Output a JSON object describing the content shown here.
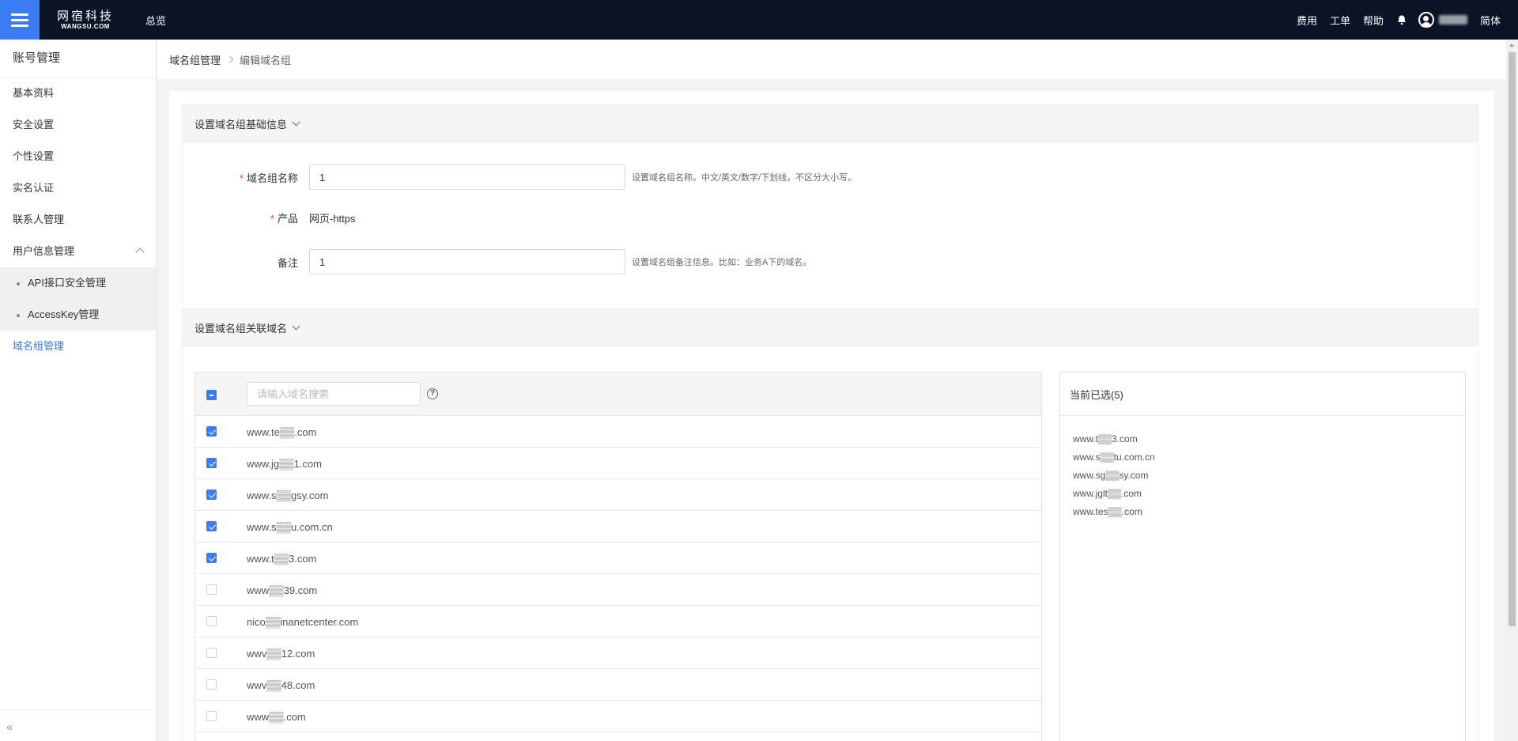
{
  "topbar": {
    "logo_cn": "网宿科技",
    "logo_en": "WANGSU.COM",
    "overview": "总览",
    "links": [
      "费用",
      "工单",
      "帮助"
    ],
    "language": "简体"
  },
  "sidebar": {
    "title": "账号管理",
    "items": [
      "基本资料",
      "安全设置",
      "个性设置",
      "实名认证",
      "联系人管理"
    ],
    "parent": "用户信息管理",
    "sub_items": [
      "API接口安全管理",
      "AccessKey管理"
    ],
    "active": "域名组管理",
    "collapse": "«"
  },
  "breadcrumb": {
    "root": "域名组管理",
    "current": "编辑域名组"
  },
  "section1": {
    "title": "设置域名组基础信息",
    "name_label": "域名组名称",
    "name_value": "1",
    "name_hint": "设置域名组名称。中文/英文/数字/下划线，不区分大小写。",
    "product_label": "产品",
    "product_value": "网页-https",
    "remark_label": "备注",
    "remark_value": "1",
    "remark_hint": "设置域名组备注信息。比如：业务A下的域名。"
  },
  "section2": {
    "title": "设置域名组关联域名",
    "search_placeholder": "请输入域名搜索",
    "help": "?",
    "domains": [
      {
        "name": "www.te▒▒.com",
        "checked": true
      },
      {
        "name": "www.jg▒▒1.com",
        "checked": true
      },
      {
        "name": "www.s▒▒gsy.com",
        "checked": true
      },
      {
        "name": "www.s▒▒u.com.cn",
        "checked": true
      },
      {
        "name": "www.t▒▒3.com",
        "checked": true
      },
      {
        "name": "www▒▒39.com",
        "checked": false
      },
      {
        "name": "nico▒▒inanetcenter.com",
        "checked": false
      },
      {
        "name": "wwv▒▒12.com",
        "checked": false
      },
      {
        "name": "wwv▒▒48.com",
        "checked": false
      },
      {
        "name": "www▒▒.com",
        "checked": false
      }
    ],
    "selected_title": "当前已选(5)",
    "selected": [
      "www.t▒▒3.com",
      "www.s▒▒tu.com.cn",
      "www.sg▒▒sy.com",
      "www.jglt▒▒.com",
      "www.tes▒▒.com"
    ]
  },
  "colors": {
    "accent": "#3a7cf4",
    "topbar": "#0b1427",
    "required": "#f04134"
  }
}
